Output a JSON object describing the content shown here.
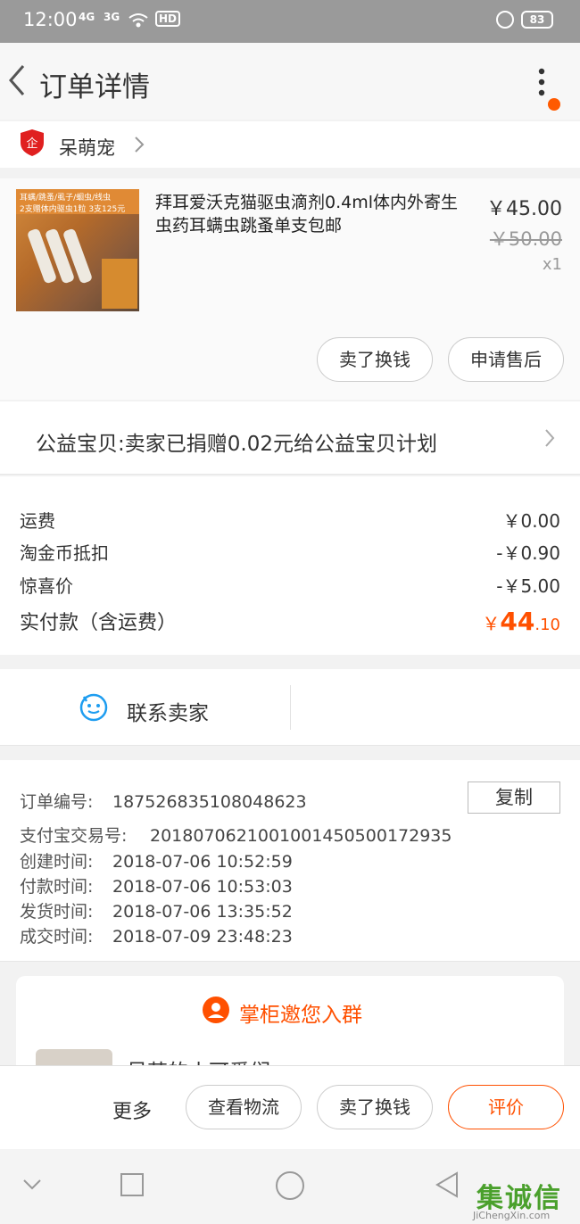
{
  "status": {
    "time": "12:00",
    "sig1": "4G",
    "sig2": "3G",
    "hd": "HD",
    "battery": "83"
  },
  "nav": {
    "title": "订单详情"
  },
  "shop": {
    "name": "呆萌宠"
  },
  "item": {
    "name": "拜耳爱沃克猫驱虫滴剂0.4ml体内外寄生虫药耳螨虫跳蚤单支包邮",
    "price": "￥45.00",
    "old_price": "￥50.00",
    "qty": "x1",
    "thumb_top_text": "耳螨/跳蚤/虱子/蛔虫/线虫",
    "thumb_mid_text": "2支赠体内驱虫1粒  3支125元",
    "btn_sell": "卖了换钱",
    "btn_after_sale": "申请售后"
  },
  "charity": {
    "text": "公益宝贝:卖家已捐赠0.02元给公益宝贝计划"
  },
  "costs": {
    "shipping_label": "运费",
    "shipping_value": "￥0.00",
    "coin_label": "淘金币抵扣",
    "coin_value": "-￥0.90",
    "surprise_label": "惊喜价",
    "surprise_value": "-￥5.00",
    "paid_label": "实付款（含运费）",
    "paid_symbol": "￥",
    "paid_int": "44",
    "paid_dec": ".10"
  },
  "contact": {
    "label": "联系卖家"
  },
  "info": {
    "order_no_label": "订单编号:",
    "order_no": "187526835108048623",
    "copy": "复制",
    "alipay_label": "支付宝交易号:",
    "alipay_no": "2018070621001001450500172935",
    "created_label": "创建时间:",
    "created": "2018-07-06 10:52:59",
    "paid_label": "付款时间:",
    "paid": "2018-07-06 10:53:03",
    "shipped_label": "发货时间:",
    "shipped": "2018-07-06 13:35:52",
    "done_label": "成交时间:",
    "done": "2018-07-09 23:48:23"
  },
  "group": {
    "title": "掌柜邀您入群",
    "name": "呆萌的小可爱们"
  },
  "actions": {
    "more": "更多",
    "logistics": "查看物流",
    "sell": "卖了换钱",
    "review": "评价"
  },
  "watermark": {
    "title": "集诚信",
    "sub": "JiChengXin.com"
  },
  "colors": {
    "accent": "#ff5000",
    "notify_dot": "#ff5a00"
  }
}
